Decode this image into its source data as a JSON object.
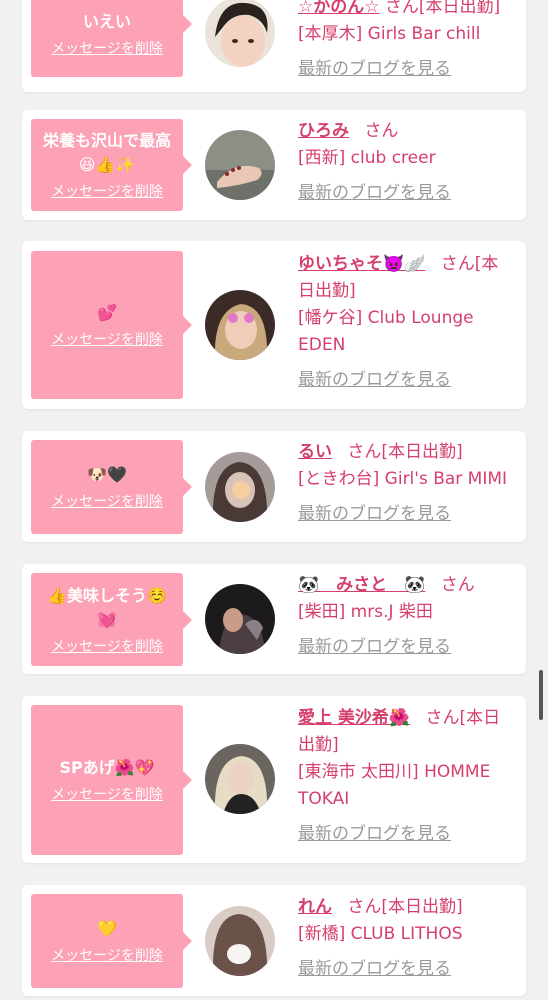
{
  "delete_label": "メッセージを削除",
  "blog_label": "最新のブログを見る",
  "san": "さん",
  "colors": {
    "accent": "#d63f6b",
    "bubble": "#fca1b6",
    "background": "#f1f1f1"
  },
  "cards": [
    {
      "message": "いえい",
      "name": "☆かのん☆",
      "suffix": "[本日出勤]",
      "shop": "[本厚木] Girls Bar chill",
      "avatar": "photo-girl-closeup"
    },
    {
      "message": "栄養も沢山で最高😆👍✨",
      "name": "ひろみ",
      "suffix": "",
      "shop": "[西新] club creer",
      "avatar": "photo-feet"
    },
    {
      "message": "💕",
      "name": "ゆいちゃそ👿🪽",
      "suffix": "[本日出勤]",
      "shop": "[幡ケ谷] Club Lounge EDEN",
      "avatar": "photo-girl-blonde"
    },
    {
      "message": "🐶🖤",
      "name": "るい",
      "suffix": "[本日出勤]",
      "shop": "[ときわ台] Girl's Bar MIMI",
      "avatar": "photo-girl-dark"
    },
    {
      "message": "👍美味しそう☺️💓",
      "name": "🐼　みさと　🐼",
      "suffix": "",
      "shop": "[柴田] mrs.J 柴田",
      "avatar": "photo-girl-night"
    },
    {
      "message": "SPあげ🌺💖",
      "name": "愛上 美沙希🌺",
      "suffix": "[本日出勤]",
      "shop": "[東海市 太田川] HOMME TOKAI",
      "avatar": "photo-girl-blonde-dress"
    },
    {
      "message": "💛",
      "name": "れん",
      "suffix": "[本日出勤]",
      "shop": "[新橋] CLUB LITHOS",
      "avatar": "photo-girl-hair"
    }
  ]
}
